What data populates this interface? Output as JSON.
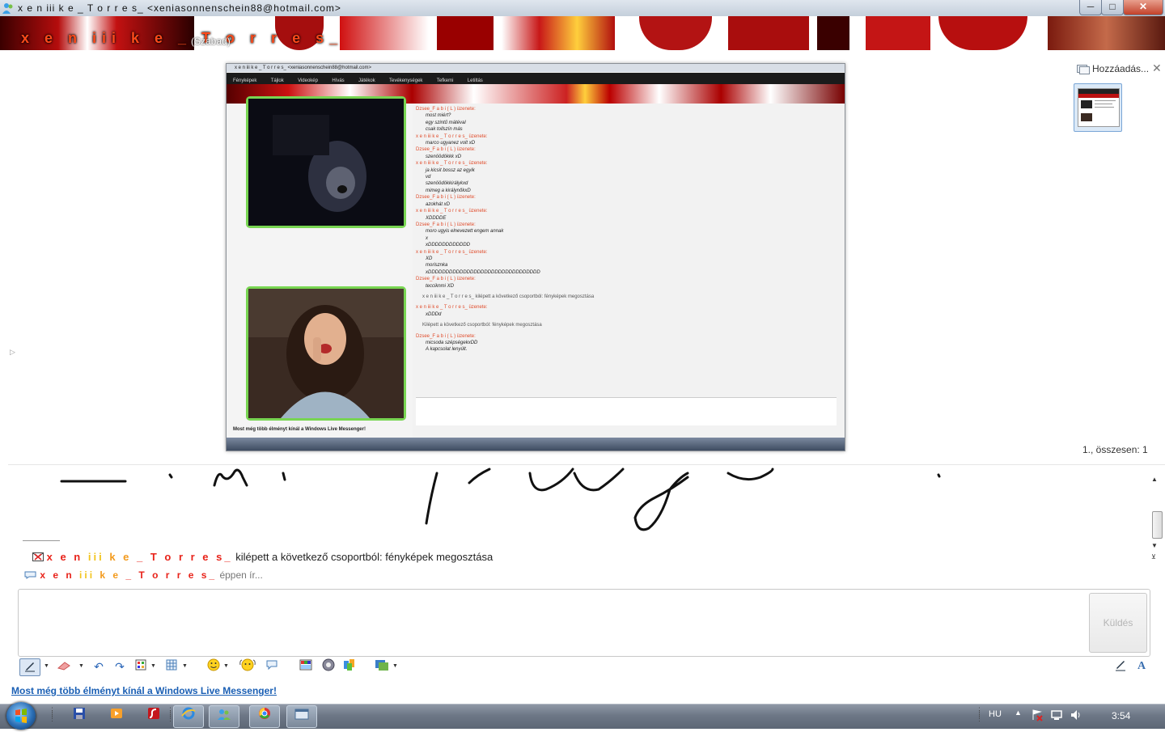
{
  "window": {
    "title": "x e n iii k e _ T o r r e s_ <xeniasonnenschein88@hotmail.com>",
    "minimize": "─",
    "maximize": "□",
    "close": "✕"
  },
  "contact": {
    "name": "x e n iii k e _ T o r r e s_",
    "name_parts": [
      "x e n ",
      "iii",
      " k e ",
      "_ T o r r e s_"
    ],
    "status": "(Szabad)"
  },
  "sharing": {
    "panel_title": "Hozzáadás...",
    "close": "✕",
    "page_counter": "1., összesen: 1",
    "expander": "▷",
    "shared_image": {
      "title": "x e n iii k e _ T o r r e s_ <xeniasonnenschein88@hotmail.com>",
      "menu": [
        "Fényképek",
        "Tájlok",
        "Videokép",
        "Hívás",
        "Játékok",
        "Tevékenységek",
        "Tefkemi",
        "Letiltás"
      ],
      "chat_lines": [
        {
          "kind": "h",
          "text": "Dzsee_F a b i ( L ) üzenete:"
        },
        {
          "kind": "m",
          "text": "most miért?"
        },
        {
          "kind": "m",
          "text": "egy szintű mátéval"
        },
        {
          "kind": "m",
          "text": "csak tollszín más"
        },
        {
          "kind": "h",
          "text": "x e n iii k e _ T o r r e s_ üzenete:"
        },
        {
          "kind": "m",
          "text": "marco ugyanez volt xD"
        },
        {
          "kind": "h",
          "text": "Dzsee_F a b i ( L ) üzenete:"
        },
        {
          "kind": "m",
          "text": "szenöödökkk xD"
        },
        {
          "kind": "h",
          "text": "x e n iii k e _ T o r r e s_ üzenete:"
        },
        {
          "kind": "m",
          "text": "ja kicsit bossz az egyik"
        },
        {
          "kind": "m",
          "text": "vd"
        },
        {
          "kind": "m",
          "text": "szenöödökkirálykxd"
        },
        {
          "kind": "m",
          "text": "mimeg a királynőkxD"
        },
        {
          "kind": "h",
          "text": "Dzsee_F a b i ( L ) üzenete:"
        },
        {
          "kind": "m",
          "text": "azokhát xD"
        },
        {
          "kind": "h",
          "text": "x e n iii k e _ T o r r e s_ üzenete:"
        },
        {
          "kind": "m",
          "text": "XDDDDE"
        },
        {
          "kind": "h",
          "text": "Dzsee_F a b i ( L ) üzenete:"
        },
        {
          "kind": "m",
          "text": "moro ugyis elnevezett engem annak"
        },
        {
          "kind": "m",
          "text": "x"
        },
        {
          "kind": "m",
          "text": "xDDDDDDDDDDDD"
        },
        {
          "kind": "h",
          "text": "x e n iii k e _ T o r r e s_ üzenete:"
        },
        {
          "kind": "m",
          "text": "XD"
        },
        {
          "kind": "m",
          "text": "morisznka"
        },
        {
          "kind": "m",
          "text": "xDDDDDDDDDDDDDDDDDDDDDDDDDDDDDDDD"
        },
        {
          "kind": "h",
          "text": "Dzsee_F a b i ( L ) üzenete:"
        },
        {
          "kind": "m",
          "text": "tecciknmi XD"
        },
        {
          "kind": "s",
          "text": "x e n iii k e _ T o r r e s_ kilépett a következő csoportból: fényképek megosztása"
        },
        {
          "kind": "h",
          "text": "x e n iii k e _ T o r r e s_ üzenete:"
        },
        {
          "kind": "m",
          "text": "xDDDd"
        },
        {
          "kind": "s",
          "text": "Kilépett a következő csoportból: fényképek megosztása"
        },
        {
          "kind": "h",
          "text": "Dzsee_F a b i ( L ) üzenete:"
        },
        {
          "kind": "m",
          "text": "micsoda szépségekxDD"
        },
        {
          "kind": "m",
          "text": "A kapcsolat lenyúlt."
        }
      ],
      "ad": "Most még több élményt kínál a Windows Live Messenger!"
    }
  },
  "conversation": {
    "status_line": "kilépett a következő csoportból: fényképek megosztása",
    "typing_suffix": "éppen ír..."
  },
  "input": {
    "send_label": "Küldés",
    "placeholder": ""
  },
  "toolbar_icons": [
    "handwriting-pen-icon",
    "eraser-icon",
    "undo-icon",
    "redo-icon",
    "pen-width-icon",
    "grid-icon",
    "emoticon-icon",
    "wink-icon",
    "nudge-icon",
    "backgrounds-icon",
    "voice-clip-icon",
    "games-icon",
    "share-icon",
    "font-icon"
  ],
  "ad_link": "Most még több élményt kínál a Windows Live Messenger!",
  "taskbar": {
    "language": "HU",
    "clock": "3:54",
    "tray_arrow": "▲"
  }
}
